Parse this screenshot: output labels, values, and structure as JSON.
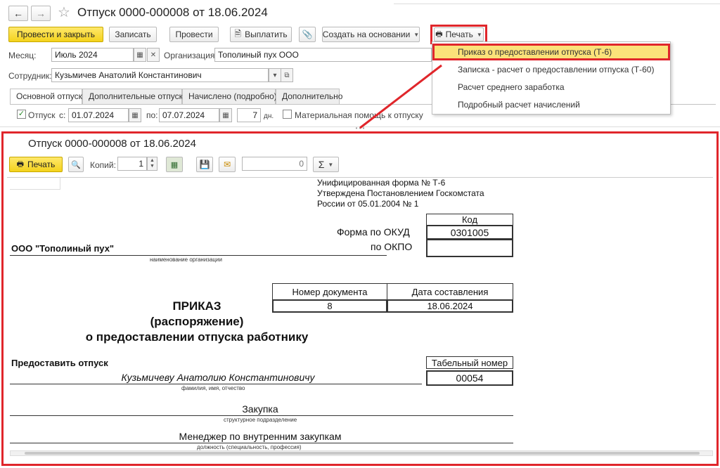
{
  "window": {
    "title": "Отпуск 0000-000008 от 18.06.2024"
  },
  "toolbar": {
    "post_close": "Провести и закрыть",
    "save": "Записать",
    "post": "Провести",
    "pay": "Выплатить",
    "create_based": "Создать на основании",
    "print": "Печать"
  },
  "print_menu": {
    "items": [
      "Приказ о предоставлении отпуска (Т-6)",
      "Записка - расчет о предоставлении отпуска (Т-60)",
      "Расчет среднего заработка",
      "Подробный расчет начислений"
    ]
  },
  "form": {
    "month_label": "Месяц:",
    "month_value": "Июль 2024",
    "org_label": "Организация:",
    "org_value": "Тополиный пух ООО",
    "employee_label": "Сотрудник:",
    "employee_value": "Кузьмичев Анатолий Константинович"
  },
  "tabs": [
    "Основной отпуск",
    "Дополнительные отпуска",
    "Начислено (подробно)",
    "Дополнительно"
  ],
  "vacation_row": {
    "checkbox_label": "Отпуск",
    "from_label": "с:",
    "from_value": "01.07.2024",
    "to_label": "по:",
    "to_value": "07.07.2024",
    "days_value": "7",
    "days_label": "дн.",
    "material_help_label": "Материальная помощь к отпуску"
  },
  "print_panel": {
    "title": "Отпуск 0000-000008 от 18.06.2024",
    "print_label": "Печать",
    "copies_label": "Копий:",
    "copies_value": "1",
    "sum_value": "0",
    "sigma": "Σ"
  },
  "document": {
    "form_header": [
      "Унифицированная форма № Т-6",
      "Утверждена Постановлением Госкомстата",
      "России от 05.01.2004 № 1"
    ],
    "code_label": "Код",
    "okud_label": "Форма по ОКУД",
    "okud_value": "0301005",
    "okpo_label": "по ОКПО",
    "organization": "ООО \"Тополиный пух\"",
    "org_caption": "наименование организации",
    "doc_number_label": "Номер документа",
    "doc_date_label": "Дата составления",
    "doc_number": "8",
    "doc_date": "18.06.2024",
    "title1": "ПРИКАЗ",
    "title2": "(распоряжение)",
    "title3": "о предоставлении отпуска работнику",
    "grant_label": "Предоставить отпуск",
    "tab_number_label": "Табельный номер",
    "tab_number": "00054",
    "employee_name": "Кузьмичеву Анатолию Константиновичу",
    "name_caption": "фамилия, имя, отчество",
    "department": "Закупка",
    "department_caption": "структурное подразделение",
    "position": "Менеджер по внутренним закупкам",
    "position_caption": "должность (специальность, профессия)"
  },
  "colors": {
    "accent_yellow": "#f4d21c",
    "highlight_red": "#e0262b",
    "menu_selected": "#fbe27a"
  }
}
